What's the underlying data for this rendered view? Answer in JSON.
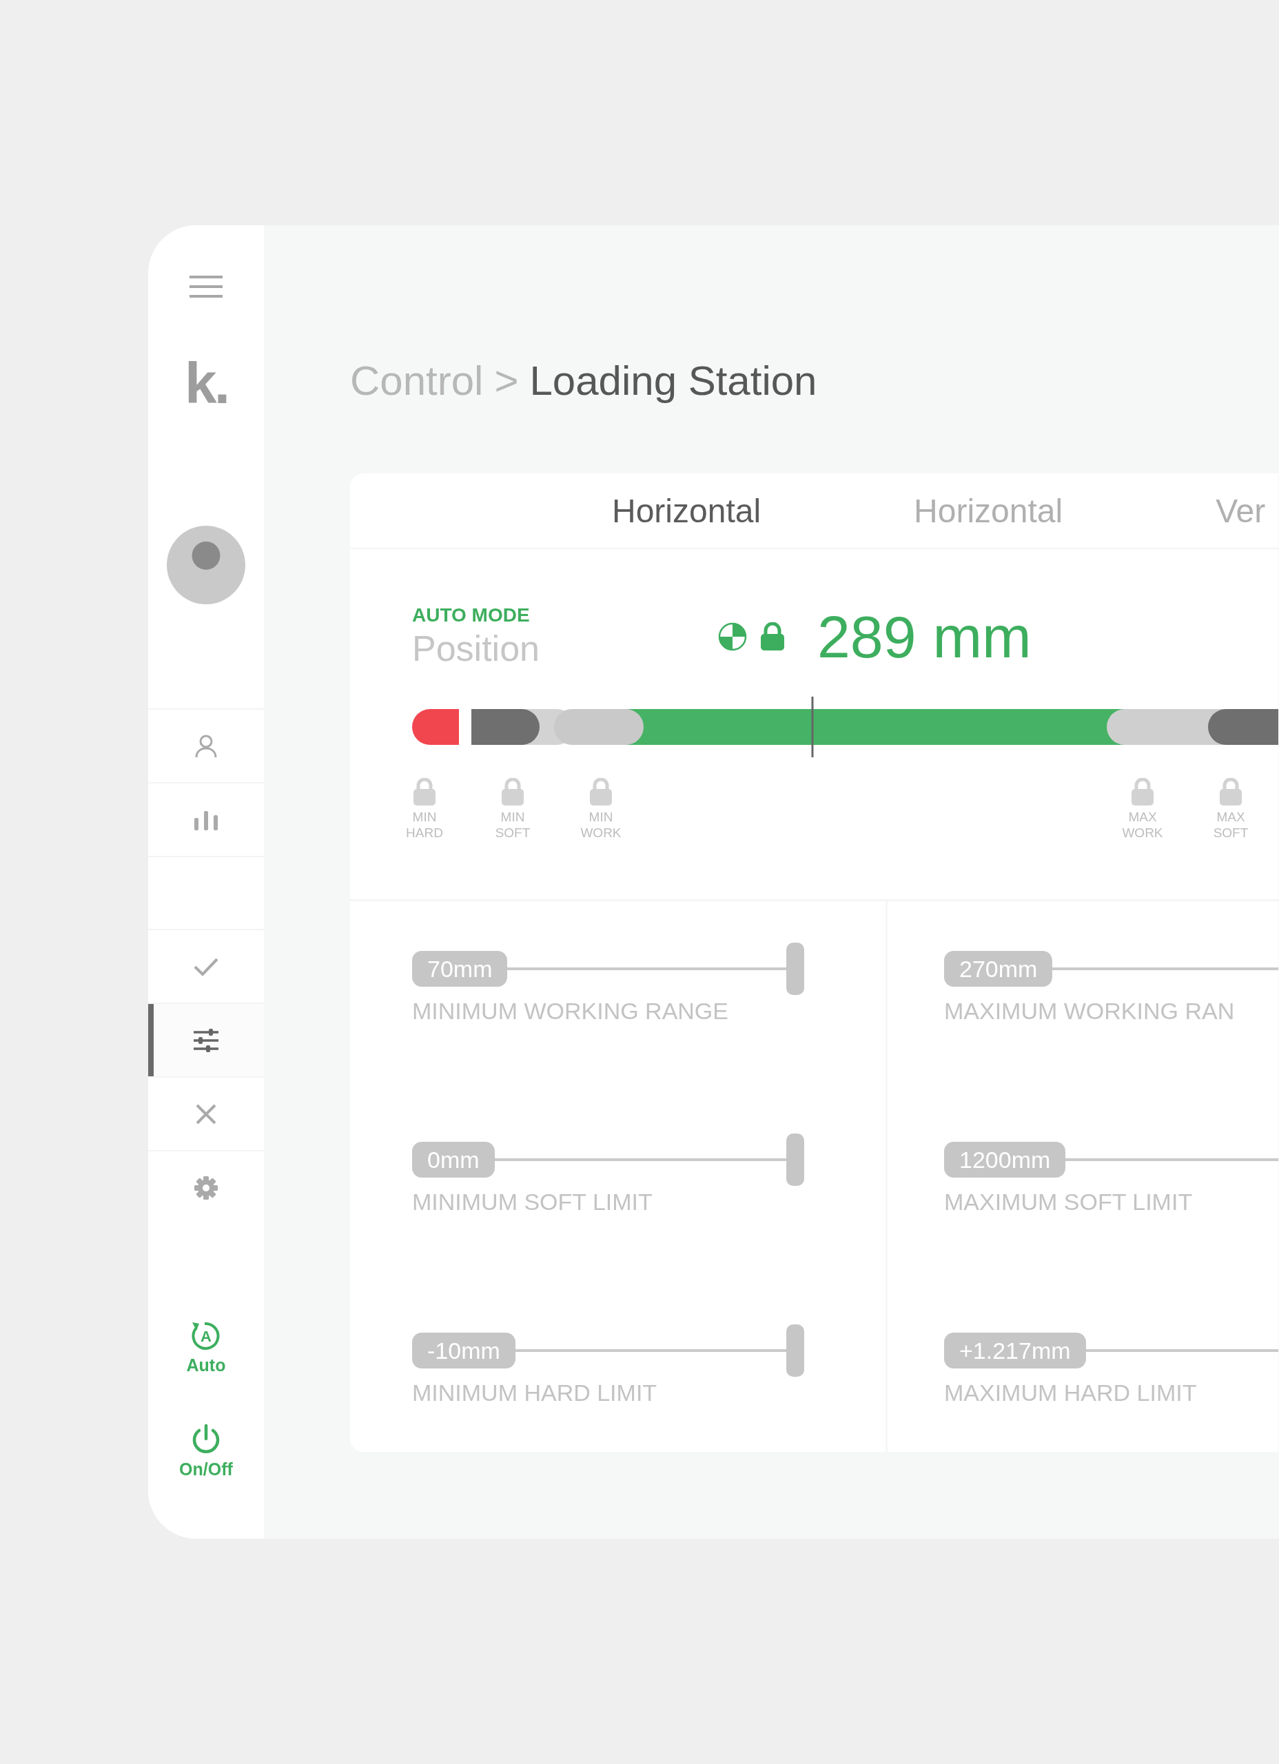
{
  "sidebar": {
    "logo": "k.",
    "nav_groups": [
      [
        {
          "kind": "user",
          "selected": false
        },
        {
          "kind": "chart",
          "selected": false
        }
      ],
      [
        {
          "kind": "check",
          "selected": false
        },
        {
          "kind": "sliders",
          "selected": true
        },
        {
          "kind": "close",
          "selected": false
        },
        {
          "kind": "settings",
          "selected": false
        }
      ]
    ],
    "mode_buttons": [
      {
        "kind": "auto",
        "icon_text": "A",
        "label": "Auto"
      },
      {
        "kind": "power",
        "label": "On/Off"
      }
    ]
  },
  "breadcrumb": {
    "parent": "Control",
    "separator": ">",
    "current": "Loading Station"
  },
  "tabs": [
    {
      "label": "Horizontal",
      "selected": true
    },
    {
      "label": "Horizontal",
      "selected": false
    },
    {
      "label": "Ver",
      "selected": false
    }
  ],
  "position": {
    "mode": "AUTO MODE",
    "label": "Position",
    "value": "289 mm",
    "locked": true,
    "limits": [
      {
        "label": "MIN HARD"
      },
      {
        "label": "MIN SOFT"
      },
      {
        "label": "MIN WORK"
      },
      {
        "label": "MAX WORK"
      },
      {
        "label": "MAX SOFT"
      }
    ]
  },
  "settings": [
    [
      {
        "value": "70mm",
        "label": "MINIMUM WORKING RANGE",
        "level": 1
      },
      {
        "value": "0mm",
        "label": "MINIMUM SOFT LIMIT",
        "level": 1
      },
      {
        "value": "-10mm",
        "label": "MINIMUM HARD LIMIT",
        "level": 1
      }
    ],
    [
      {
        "value": "270mm",
        "label": "MAXIMUM WORKING RAN",
        "level": 1
      },
      {
        "value": "1200mm",
        "label": "MAXIMUM SOFT LIMIT",
        "level": 1
      },
      {
        "value": "+1.217mm",
        "label": "MAXIMUM HARD LIMIT",
        "level": 1
      }
    ]
  ]
}
